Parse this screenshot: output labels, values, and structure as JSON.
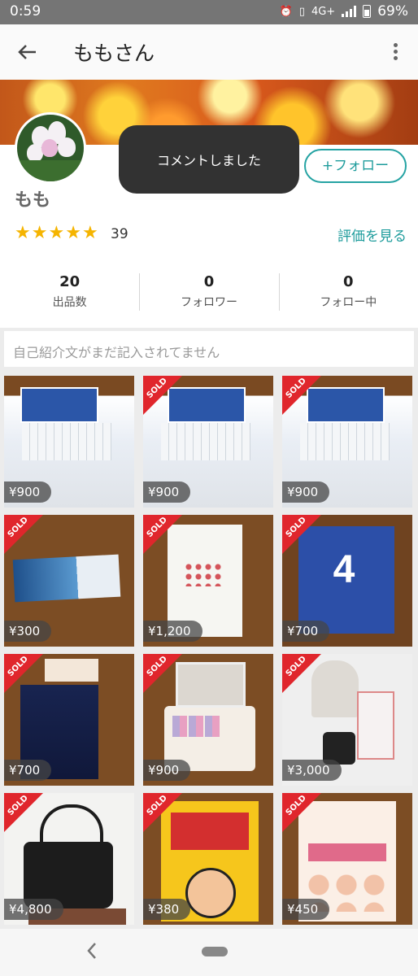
{
  "status_bar": {
    "time": "0:59",
    "network": "4G+",
    "battery": "69%"
  },
  "app_bar": {
    "title": "ももさん"
  },
  "profile": {
    "name": "もも",
    "follow_label": "+フォロー",
    "rating_stars": 5,
    "rating_count": "39",
    "see_reviews_label": "評価を見る",
    "stats": [
      {
        "value": "20",
        "label": "出品数"
      },
      {
        "value": "0",
        "label": "フォロワー"
      },
      {
        "value": "0",
        "label": "フォロー中"
      }
    ]
  },
  "toast": {
    "message": "コメントしました"
  },
  "bio": {
    "text": "自己紹介文がまだ記入されてません"
  },
  "items": [
    {
      "price": "¥900",
      "sold": false,
      "sold_label": ""
    },
    {
      "price": "¥900",
      "sold": true,
      "sold_label": "SOLD"
    },
    {
      "price": "¥900",
      "sold": true,
      "sold_label": "SOLD"
    },
    {
      "price": "¥300",
      "sold": true,
      "sold_label": "SOLD"
    },
    {
      "price": "¥1,200",
      "sold": true,
      "sold_label": "SOLD"
    },
    {
      "price": "¥700",
      "sold": true,
      "sold_label": "SOLD"
    },
    {
      "price": "¥700",
      "sold": true,
      "sold_label": "SOLD"
    },
    {
      "price": "¥900",
      "sold": true,
      "sold_label": "SOLD"
    },
    {
      "price": "¥3,000",
      "sold": true,
      "sold_label": "SOLD"
    },
    {
      "price": "¥4,800",
      "sold": true,
      "sold_label": "SOLD"
    },
    {
      "price": "¥380",
      "sold": true,
      "sold_label": "SOLD"
    },
    {
      "price": "¥450",
      "sold": true,
      "sold_label": "SOLD"
    }
  ],
  "colors": {
    "accent": "#1e9c9c",
    "sold_ribbon": "#e0262c",
    "star": "#f5b400"
  },
  "icons": {
    "back": "arrow-left-icon",
    "menu": "more-vertical-icon",
    "nav_back": "chevron-left-icon"
  }
}
